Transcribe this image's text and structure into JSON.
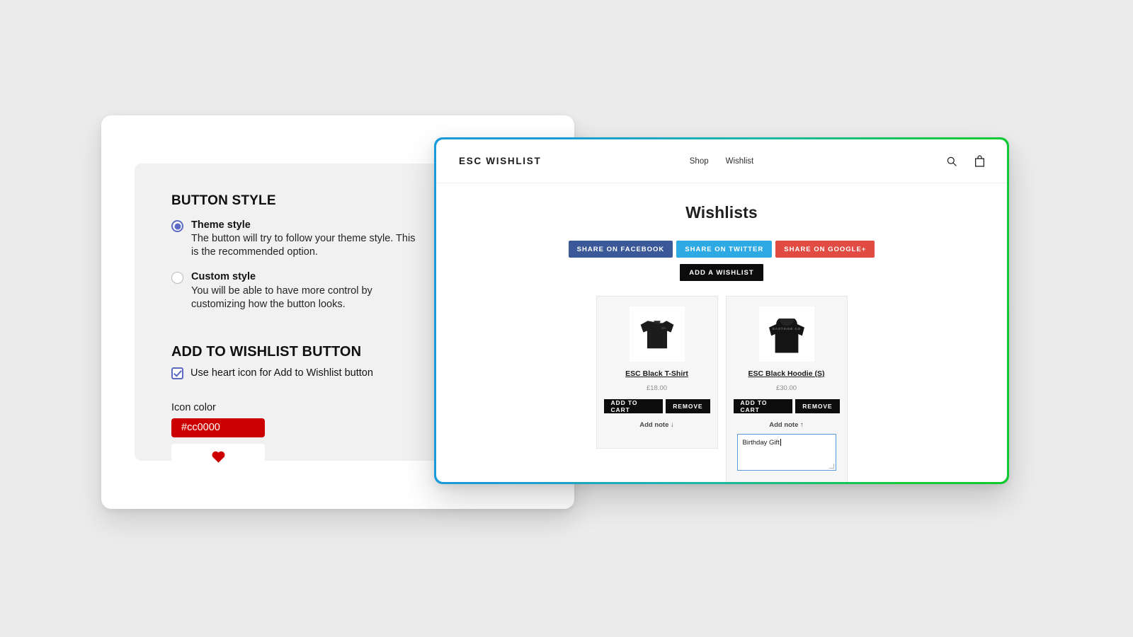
{
  "admin": {
    "button_style": {
      "heading": "BUTTON STYLE",
      "options": [
        {
          "label": "Theme style",
          "help": "The button will try to follow your theme style. This is the recommended option.",
          "selected": true
        },
        {
          "label": "Custom style",
          "help": "You will be able to have more control by customizing how the button looks.",
          "selected": false
        }
      ]
    },
    "add_to_wishlist": {
      "heading": "ADD TO WISHLIST BUTTON",
      "checkbox_label": "Use heart icon for Add to Wishlist button",
      "checkbox_checked": true,
      "icon_color_label": "Icon color",
      "icon_color_value": "#cc0000",
      "icon_color_hex": "#cc0000",
      "preview_icon": "heart-icon"
    },
    "accent_color": "#5c6ac4"
  },
  "storefront": {
    "window_border_start": "#1a9ad8",
    "window_border_end": "#0ec92f",
    "header": {
      "logo": "ESC WISHLIST",
      "nav": [
        {
          "label": "Shop"
        },
        {
          "label": "Wishlist"
        }
      ],
      "icons": [
        {
          "name": "search-icon"
        },
        {
          "name": "cart-icon"
        }
      ]
    },
    "page_title": "Wishlists",
    "share_buttons": [
      {
        "label": "SHARE ON FACEBOOK",
        "color": "#3b5998"
      },
      {
        "label": "SHARE ON TWITTER",
        "color": "#2daae4"
      },
      {
        "label": "SHARE ON GOOGLE+",
        "color": "#e14b41"
      }
    ],
    "add_wishlist_label": "ADD A WISHLIST",
    "products": [
      {
        "name": "ESC Black T-Shirt",
        "price": "£18.00",
        "image_alt": "black-tshirt",
        "add_to_cart_label": "ADD TO CART",
        "remove_label": "REMOVE",
        "note_toggle_label": "Add note ↓",
        "note_expanded": false,
        "note_value": ""
      },
      {
        "name": "ESC Black Hoodie (S)",
        "price": "£30.00",
        "image_alt": "black-hoodie",
        "image_print": "EASTSIDE CO",
        "add_to_cart_label": "ADD TO CART",
        "remove_label": "REMOVE",
        "note_toggle_label": "Add note ↑",
        "note_expanded": true,
        "note_value": "Birthday Gift"
      }
    ]
  }
}
